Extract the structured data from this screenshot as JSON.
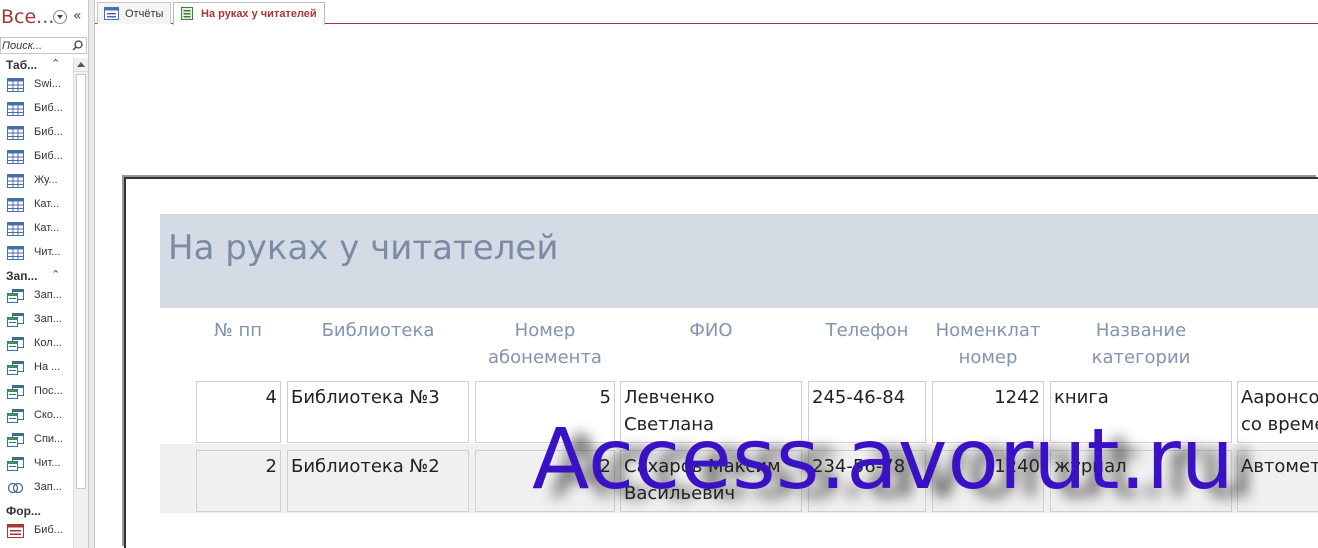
{
  "nav": {
    "title": "Все...",
    "search_placeholder": "Поиск...",
    "groups": [
      {
        "label": "Таб...",
        "items": [
          "Swi...",
          "Биб...",
          "Биб...",
          "Биб...",
          "Жу...",
          "Кат...",
          "Кат...",
          "Чит..."
        ]
      },
      {
        "label": "Зап...",
        "items": [
          "Зап...",
          "Зап...",
          "Кол...",
          "На ...",
          "Пос...",
          "Ско...",
          "Спи...",
          "Чит...",
          "Зап..."
        ]
      },
      {
        "label": "Фор...",
        "items": [
          "Биб..."
        ]
      }
    ]
  },
  "tabs": [
    {
      "label": "Отчёты",
      "icon": "form-icon"
    },
    {
      "label": "На руках у читателей",
      "icon": "report-icon",
      "active": true
    }
  ],
  "report": {
    "title": "На руках у читателей",
    "columns": [
      [
        "№ пп"
      ],
      [
        "Библиотека"
      ],
      [
        "Номер",
        "абонемента"
      ],
      [
        "ФИО"
      ],
      [
        "Телефон"
      ],
      [
        "Номенклат",
        "номер"
      ],
      [
        "Название",
        "категории"
      ]
    ],
    "rows": [
      {
        "num": "4",
        "library": "Библиотека №3",
        "subscription": "5",
        "fio_1": "Левченко",
        "fio_2": "Светлана",
        "phone": "245-46-84",
        "nomenclature": "1242",
        "category": "книга",
        "title_1": "Аaронсо",
        "title_2": "со време"
      },
      {
        "num": "2",
        "library": "Библиотека №2",
        "subscription": "2",
        "fio_1": "Сахаров Максим",
        "fio_2": "Васильевич",
        "phone": "234-56-78",
        "nomenclature": "1240",
        "category": "журнал",
        "title_1": "Автомет",
        "title_2": ""
      }
    ]
  },
  "watermark": "Access.avorut.ru",
  "colors": {
    "accent": "#a4373a",
    "header_band": "#d5dbe5",
    "header_text": "#7a8ba6",
    "watermark": "#3a11c4"
  }
}
